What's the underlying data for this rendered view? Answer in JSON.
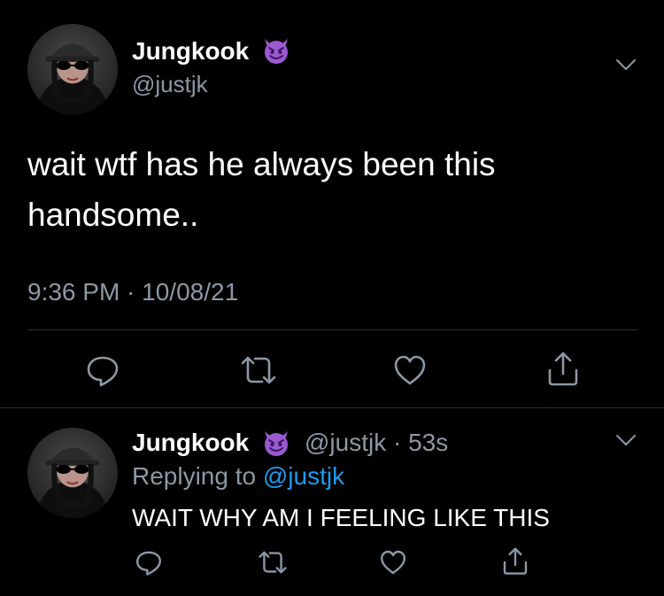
{
  "main_tweet": {
    "display_name": "Jungkook",
    "name_emoji": "smiling-imp-emoji",
    "handle": "@justjk",
    "text_line1": "wait wtf has he always been this",
    "text_line2": "handsome..",
    "timestamp": "9:36 PM · 10/08/21"
  },
  "reply_tweet": {
    "display_name": "Jungkook",
    "name_emoji": "smiling-imp-emoji",
    "handle_time": "@justjk · 53s",
    "replying_prefix": "Replying to",
    "replying_handle": "@justjk",
    "text": "WAIT WHY AM I FEELING LIKE THIS"
  },
  "icons": [
    "reply-icon",
    "retweet-icon",
    "like-icon",
    "share-icon",
    "chevron-down-icon"
  ],
  "colors": {
    "background": "#000000",
    "text": "#ffffff",
    "secondary": "#8b98a5",
    "link": "#1d9bf0",
    "divider": "#2f3336",
    "emoji": "#9b59d0"
  }
}
